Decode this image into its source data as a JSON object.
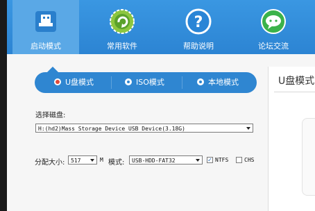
{
  "nav": {
    "items": [
      {
        "label": "启动模式",
        "icon": "usb-drive-icon",
        "active": true
      },
      {
        "label": "常用软件",
        "icon": "software-gear-icon",
        "active": false
      },
      {
        "label": "帮助说明",
        "icon": "help-question-icon",
        "active": false
      },
      {
        "label": "论坛交流",
        "icon": "chat-bubble-icon",
        "active": false
      }
    ]
  },
  "modes": {
    "tabs": [
      {
        "label": "U盘模式",
        "selected": true
      },
      {
        "label": "ISO模式",
        "selected": false
      },
      {
        "label": "本地模式",
        "selected": false
      }
    ]
  },
  "right_panel": {
    "title": "U盘模式"
  },
  "disk": {
    "label": "选择磁盘:",
    "selected": "H:(hd2)Mass Storage Device USB Device(3.18G)"
  },
  "options": {
    "size_label": "分配大小:",
    "size_value": "517",
    "size_unit": "M",
    "mode_label": "模式:",
    "mode_value": "USB-HDD-FAT32",
    "ntfs_label": "NTFS",
    "ntfs_checked": true,
    "chs_label": "CHS",
    "chs_checked": false
  },
  "colors": {
    "header": "#2c84d3",
    "pill": "#2f86d1",
    "radio_selected": "#e04a3a"
  }
}
